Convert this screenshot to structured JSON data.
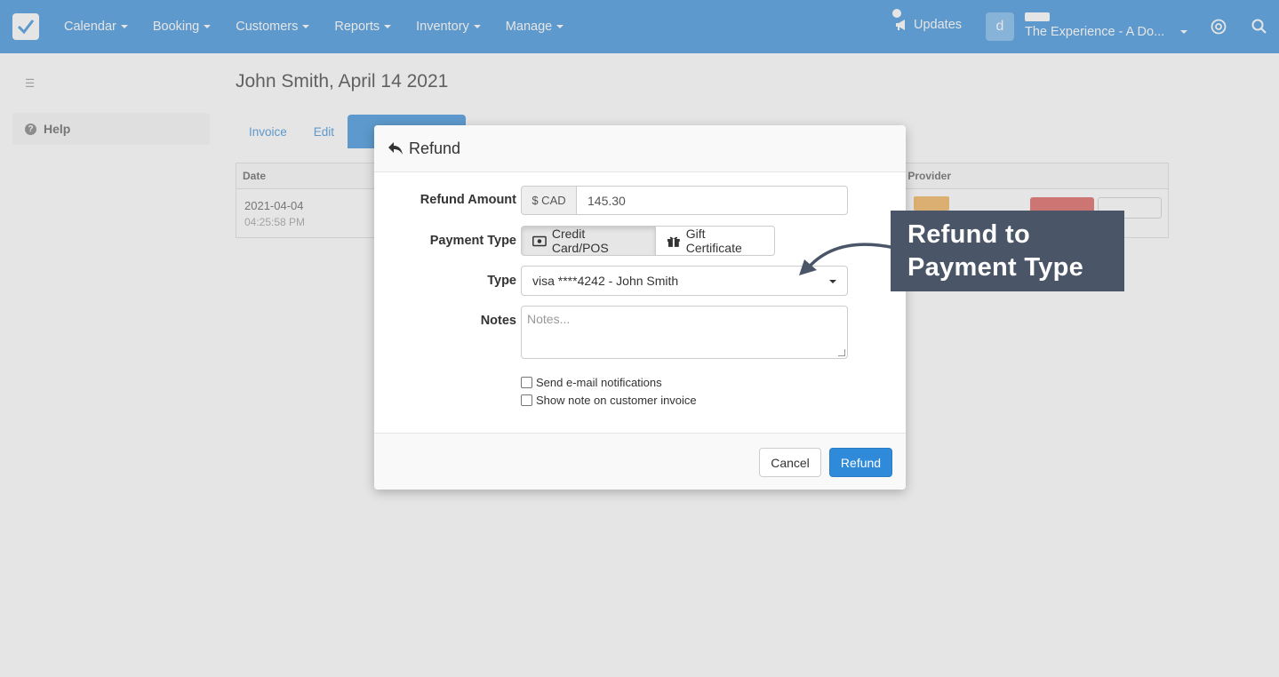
{
  "navbar": {
    "menu": [
      {
        "label": "Calendar"
      },
      {
        "label": "Booking"
      },
      {
        "label": "Customers"
      },
      {
        "label": "Reports"
      },
      {
        "label": "Inventory"
      },
      {
        "label": "Manage"
      }
    ],
    "updates_label": "Updates",
    "avatar_letter": "d",
    "account_name": "The Experience - A Do..."
  },
  "sidebar": {
    "help_label": "Help"
  },
  "page": {
    "title": "John Smith, April 14 2021",
    "tabs": [
      {
        "label": "Invoice"
      },
      {
        "label": "Edit"
      }
    ],
    "table": {
      "col_date": "Date",
      "col_provider": "t Provider",
      "row": {
        "date": "2021-04-04",
        "time": "04:25:58 PM"
      }
    }
  },
  "modal": {
    "title": "Refund",
    "refund_amount_label": "Refund Amount",
    "currency_addon": "$ CAD",
    "amount_value": "145.30",
    "payment_type_label": "Payment Type",
    "payment_options": [
      "Credit Card/POS",
      "Gift Certificate"
    ],
    "selected_payment": "Credit Card/POS",
    "type_label": "Type",
    "type_value": "visa ****4242 - John Smith",
    "notes_label": "Notes",
    "notes_placeholder": "Notes...",
    "checkboxes": [
      {
        "label": "Send e-mail notifications",
        "checked": false
      },
      {
        "label": "Show note on customer invoice",
        "checked": false
      }
    ],
    "cancel_label": "Cancel",
    "refund_label": "Refund"
  },
  "callout": {
    "line1": "Refund to",
    "line2": "Payment Type",
    "color": "#4a5668"
  },
  "colors": {
    "brand": "#2f8bd9",
    "callout_bg": "#4a5668"
  }
}
